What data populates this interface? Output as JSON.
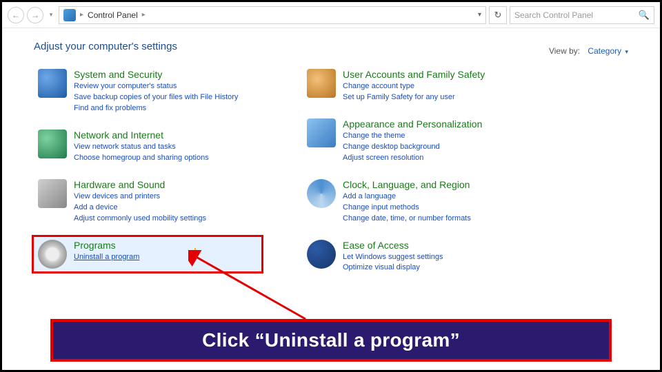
{
  "toolbar": {
    "breadcrumb_root": "Control Panel",
    "search_placeholder": "Search Control Panel"
  },
  "heading": "Adjust your computer's settings",
  "viewby": {
    "label": "View by:",
    "value": "Category"
  },
  "left": [
    {
      "title": "System and Security",
      "links": [
        "Review your computer's status",
        "Save backup copies of your files with File History",
        "Find and fix problems"
      ]
    },
    {
      "title": "Network and Internet",
      "links": [
        "View network status and tasks",
        "Choose homegroup and sharing options"
      ]
    },
    {
      "title": "Hardware and Sound",
      "links": [
        "View devices and printers",
        "Add a device",
        "Adjust commonly used mobility settings"
      ]
    },
    {
      "title": "Programs",
      "links": [
        "Uninstall a program"
      ]
    }
  ],
  "right": [
    {
      "title": "User Accounts and Family Safety",
      "links": [
        "Change account type",
        "Set up Family Safety for any user"
      ]
    },
    {
      "title": "Appearance and Personalization",
      "links": [
        "Change the theme",
        "Change desktop background",
        "Adjust screen resolution"
      ]
    },
    {
      "title": "Clock, Language, and Region",
      "links": [
        "Add a language",
        "Change input methods",
        "Change date, time, or number formats"
      ]
    },
    {
      "title": "Ease of Access",
      "links": [
        "Let Windows suggest settings",
        "Optimize visual display"
      ]
    }
  ],
  "caption": "Click “Uninstall a program”"
}
